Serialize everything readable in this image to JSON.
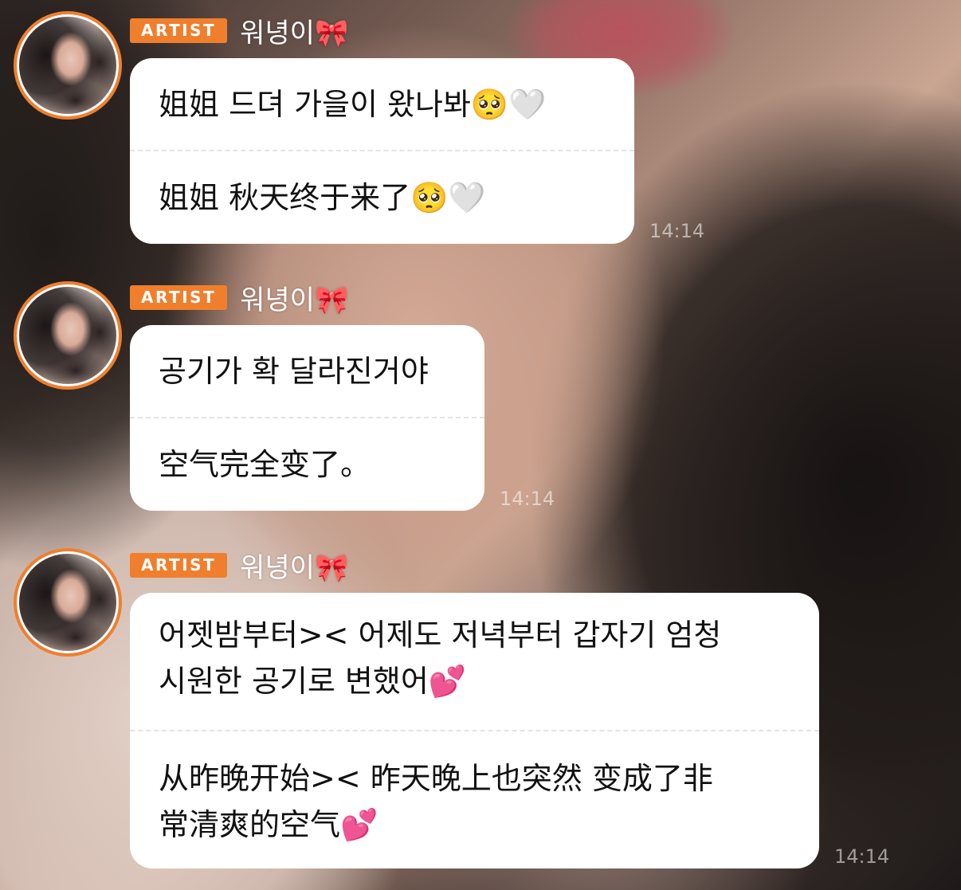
{
  "messages": [
    {
      "badge": "ARTIST",
      "name": "워녕이🎀",
      "korean": "姐姐 드뎌 가을이 왔나봐🥺🤍",
      "chinese": "姐姐 秋天终于来了🥺🤍",
      "time": "14:14"
    },
    {
      "badge": "ARTIST",
      "name": "워녕이🎀",
      "korean": "공기가 확 달라진거야",
      "chinese": "空气完全变了。",
      "time": "14:14"
    },
    {
      "badge": "ARTIST",
      "name": "워녕이🎀",
      "korean_line1": "어젯밤부터>< 어제도 저녁부터 갑자기 엄청",
      "korean_line2": "시원한 공기로 변했어💕",
      "chinese_line1": "从昨晚开始>< 昨天晚上也突然 变成了非",
      "chinese_line2": "常清爽的空气💕",
      "time": "14:14"
    }
  ]
}
